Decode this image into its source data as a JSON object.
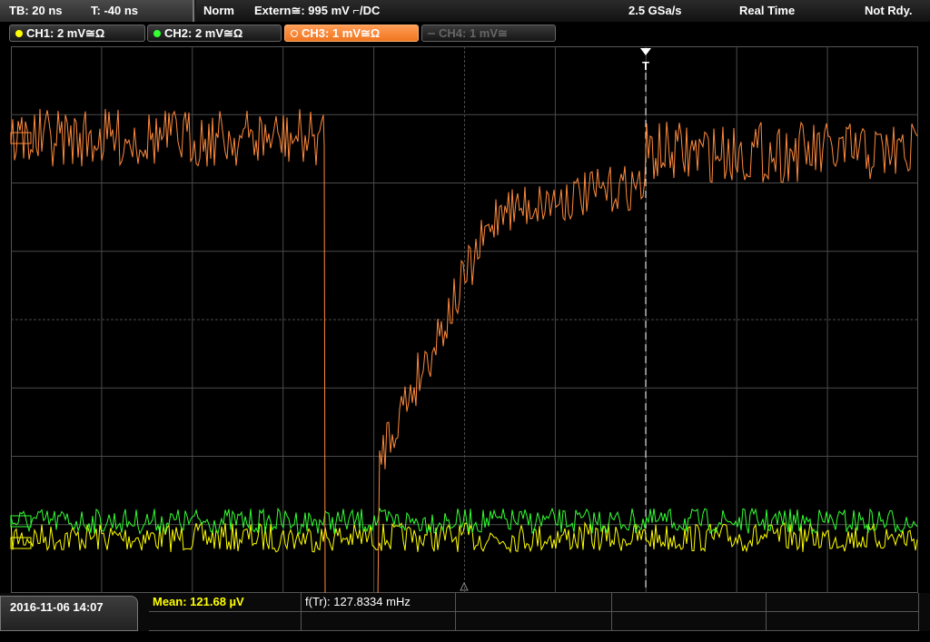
{
  "header": {
    "timebase": "TB: 20 ns",
    "trigger_time": "T: -40 ns",
    "mode": "Norm",
    "trigger_source": "Extern≅: 995 mV ⌐/DC",
    "sample_rate": "2.5 GSa/s",
    "acq_mode": "Real Time",
    "status": "Not Rdy."
  },
  "channels": [
    {
      "label": "CH1: 2 mV≅Ω",
      "color": "#ffff00",
      "state": "on"
    },
    {
      "label": "CH2: 2 mV≅Ω",
      "color": "#33ff33",
      "state": "on"
    },
    {
      "label": "CH3: 1 mV≅Ω",
      "color": "#ff8a3d",
      "state": "active"
    },
    {
      "label": "CH4: 1 mV≅",
      "color": "#555555",
      "state": "off"
    }
  ],
  "trigger_marker": "T",
  "footer": {
    "datetime": "2016-11-06 14:07",
    "measurements": [
      {
        "text": "Mean: 121.68 µV",
        "color": "#ffff00"
      },
      {
        "text": "f(Tr): 127.8334 mHz",
        "color": "#ffffff"
      }
    ]
  },
  "colors": {
    "ch1": "#ffff00",
    "ch2": "#33ff33",
    "ch3": "#ff8a3d",
    "grid": "#4a4a4a"
  }
}
